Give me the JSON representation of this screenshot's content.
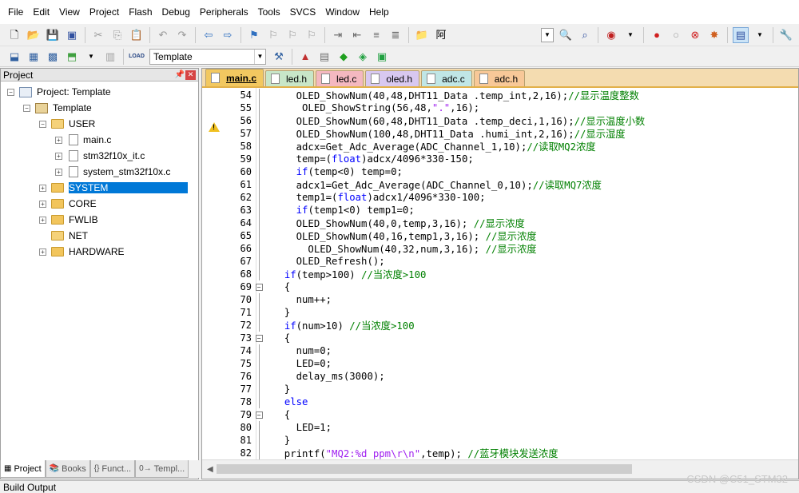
{
  "menu": [
    "File",
    "Edit",
    "View",
    "Project",
    "Flash",
    "Debug",
    "Peripherals",
    "Tools",
    "SVCS",
    "Window",
    "Help"
  ],
  "toolbar": {
    "find_char": "阿",
    "target_name": "Template"
  },
  "project_panel": {
    "title": "Project",
    "tree": {
      "project": "Project: Template",
      "target": "Template",
      "groups": {
        "user": "USER",
        "system": "SYSTEM",
        "core": "CORE",
        "fwlib": "FWLIB",
        "net": "NET",
        "hardware": "HARDWARE"
      },
      "files": [
        "main.c",
        "stm32f10x_it.c",
        "system_stm32f10x.c"
      ]
    },
    "tabs": [
      "Project",
      "Books",
      "Funct...",
      "Templ..."
    ]
  },
  "editor": {
    "tabs": [
      {
        "label": "main.c",
        "active": true,
        "color": "#f2c860"
      },
      {
        "label": "led.h",
        "active": false,
        "color": "#c8e6c8"
      },
      {
        "label": "led.c",
        "active": false,
        "color": "#f4b8c0"
      },
      {
        "label": "oled.h",
        "active": false,
        "color": "#d8c8f0"
      },
      {
        "label": "adc.c",
        "active": false,
        "color": "#c0e6e6"
      },
      {
        "label": "adc.h",
        "active": false,
        "color": "#f8c898"
      }
    ],
    "lines": [
      {
        "n": "54",
        "fold": "line",
        "text": "    OLED_ShowNum(40,48,DHT11_Data .temp_int,2,16);//显示温度整数"
      },
      {
        "n": "55",
        "fold": "line",
        "text": "     OLED_ShowString(56,48,\".\",16);"
      },
      {
        "n": "56",
        "fold": "line",
        "text": "    OLED_ShowNum(60,48,DHT11_Data .temp_deci,1,16);//显示温度小数"
      },
      {
        "n": "57",
        "fold": "line",
        "text": "    OLED_ShowNum(100,48,DHT11_Data .humi_int,2,16);//显示湿度"
      },
      {
        "n": "58",
        "fold": "line",
        "text": "    adcx=Get_Adc_Average(ADC_Channel_1,10);//读取MQ2浓度"
      },
      {
        "n": "59",
        "fold": "line",
        "text": "    temp=(float)adcx/4096*330-150;"
      },
      {
        "n": "60",
        "fold": "line",
        "text": "    if(temp<0) temp=0;"
      },
      {
        "n": "61",
        "fold": "line",
        "text": "    adcx1=Get_Adc_Average(ADC_Channel_0,10);//读取MQ7浓度"
      },
      {
        "n": "62",
        "fold": "line",
        "text": "    temp1=(float)adcx1/4096*330-100;"
      },
      {
        "n": "63",
        "fold": "line",
        "text": "    if(temp1<0) temp1=0;"
      },
      {
        "n": "64",
        "fold": "line",
        "text": "    OLED_ShowNum(40,0,temp,3,16); //显示浓度"
      },
      {
        "n": "65",
        "fold": "line",
        "text": "    OLED_ShowNum(40,16,temp1,3,16); //显示浓度"
      },
      {
        "n": "66",
        "fold": "line",
        "text": "      OLED_ShowNum(40,32,num,3,16); //显示浓度"
      },
      {
        "n": "67",
        "fold": "line",
        "text": "    OLED_Refresh();"
      },
      {
        "n": "68",
        "fold": "line",
        "text": "  if(temp>100) //当浓度>100"
      },
      {
        "n": "69",
        "fold": "box",
        "text": "  {"
      },
      {
        "n": "70",
        "fold": "line",
        "text": "    num++;"
      },
      {
        "n": "71",
        "fold": "line",
        "text": "  }"
      },
      {
        "n": "72",
        "fold": "line",
        "text": "  if(num>10) //当浓度>100"
      },
      {
        "n": "73",
        "fold": "box",
        "text": "  {"
      },
      {
        "n": "74",
        "fold": "line",
        "text": "    num=0;"
      },
      {
        "n": "75",
        "fold": "line",
        "text": "    LED=0;"
      },
      {
        "n": "76",
        "fold": "line",
        "text": "    delay_ms(3000);"
      },
      {
        "n": "77",
        "fold": "line",
        "text": "  }"
      },
      {
        "n": "78",
        "fold": "line",
        "text": "  else"
      },
      {
        "n": "79",
        "fold": "box",
        "text": "  {"
      },
      {
        "n": "80",
        "fold": "line",
        "text": "    LED=1;"
      },
      {
        "n": "81",
        "fold": "line",
        "text": "  }"
      },
      {
        "n": "82",
        "fold": "line",
        "text": "  printf(\"MQ2:%d ppm\\r\\n\",temp); //蓝牙模块发送浓度"
      }
    ]
  },
  "build_output": "Build Output",
  "watermark": "CSDN @C51_STM32",
  "colors": {
    "selection": "#0078d7",
    "comment": "#008000",
    "keyword": "#0000ff",
    "string": "#a020f0",
    "tabbar": "#f4dcb0"
  }
}
